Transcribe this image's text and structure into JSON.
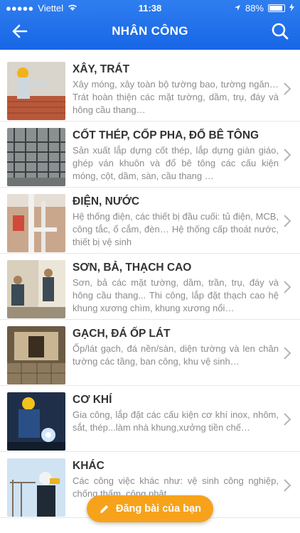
{
  "status_bar": {
    "carrier": "Viettel",
    "time": "11:38",
    "battery": "88%",
    "battery_level": 0.88
  },
  "header": {
    "title": "NHÂN CÔNG"
  },
  "items": [
    {
      "title": "XÂY, TRÁT",
      "desc": "Xây móng, xây toàn bộ tường bao, tường ngăn… Trát hoàn thiện các mặt tường, dầm, trụ, đáy và hông cầu thang…"
    },
    {
      "title": "CỐT THÉP, CỐP PHA, ĐỔ BÊ TÔNG",
      "desc": "Sản xuất lắp dựng cốt thép, lắp dựng giàn giáo, ghép ván khuôn và đổ bê tông các cấu kiện móng, cột, dầm, sàn, cầu thang …"
    },
    {
      "title": "ĐIỆN, NƯỚC",
      "desc": "Hệ thống điện, các thiết bị đầu cuối: tủ điện, MCB, công tắc, ổ cắm, đèn… Hệ thống cấp thoát nước, thiết bị vệ sinh"
    },
    {
      "title": "SƠN, BẢ, THẠCH CAO",
      "desc": "Sơn, bả các mặt tường, dầm, trần, trụ, đáy và hông cầu thang... Thi công, lắp đặt thạch cao hệ khung xương chìm, khung xương nổi…"
    },
    {
      "title": "GẠCH, ĐÁ ỐP LÁT",
      "desc": "Ốp/lát gạch, đá nền/sàn, diện tường và len chân tường các tầng, ban công, khu vệ sinh…"
    },
    {
      "title": "CƠ KHÍ",
      "desc": "Gia công, lắp đặt các cấu kiện cơ khí inox, nhôm, sắt, thép...làm nhà khung,xưởng tiền chế…"
    },
    {
      "title": "KHÁC",
      "desc": "Các công việc khác như: vệ sinh công nghiệp, chống thấm, công phật…"
    }
  ],
  "fab": {
    "label": "Đăng bài của bạn"
  },
  "colors": {
    "header": "#1d6fe9",
    "fab": "#f7a21b"
  },
  "icons": [
    "back-arrow-icon",
    "search-icon",
    "chevron-right-icon",
    "pencil-icon"
  ]
}
